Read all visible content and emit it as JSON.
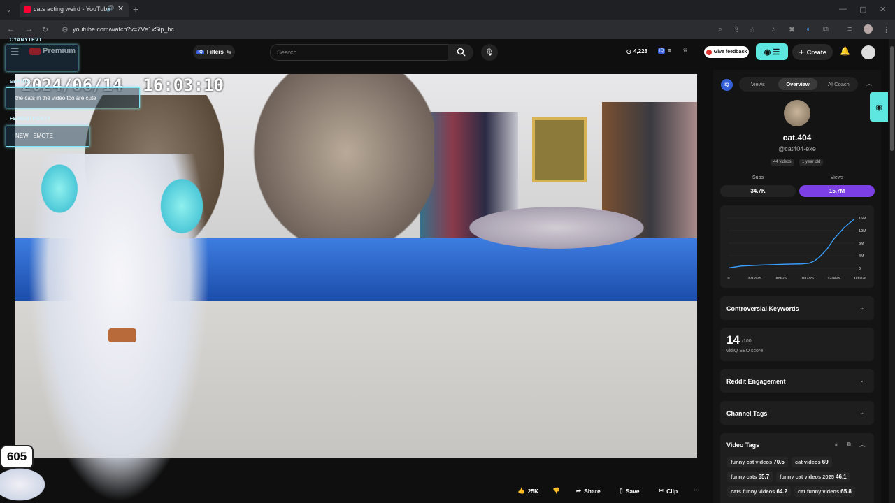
{
  "browser": {
    "tab_title": "cats acting weird - YouTube",
    "url": "youtube.com/watch?v=7Ve1xSip_bc"
  },
  "header": {
    "logo_text": "Premium",
    "filters_label": "Filters",
    "search_placeholder": "Search",
    "views_count": "4,228",
    "give_feedback": "Give feedback",
    "create_label": "Create"
  },
  "overlay": {
    "timestamp": "2024/06/14  16:03:10",
    "counter": "605",
    "chat": [
      {
        "user": "CYANYTEVT",
        "message": ""
      },
      {
        "user": "SEKRID",
        "message": "the cats in the video too are cute"
      },
      {
        "user": "FEMBOTFOXXY",
        "message": "NEW   EMOTE"
      }
    ]
  },
  "actions": {
    "likes": "25K",
    "share": "Share",
    "save": "Save",
    "clip": "Clip"
  },
  "sidebar": {
    "tabs": [
      "Views",
      "Overview",
      "AI Coach"
    ],
    "channel_name": "cat.404",
    "handle": "@cat404-exe",
    "videos": "44 videos",
    "age": "1 year old",
    "subs_label": "Subs",
    "subs_value": "34.7K",
    "views_label": "Views",
    "views_value": "15.7M",
    "controversial": "Controversial Keywords",
    "seo_score": "14",
    "seo_max": "/100",
    "seo_label": "vidIQ SEO score",
    "reddit": "Reddit Engagement",
    "channel_tags": "Channel Tags",
    "video_tags": "Video Tags",
    "tags": [
      {
        "name": "funny cat videos",
        "score": "70.5"
      },
      {
        "name": "cat videos",
        "score": "69"
      },
      {
        "name": "funny cats",
        "score": "65.7"
      },
      {
        "name": "funny cat videos 2025",
        "score": "46.1"
      },
      {
        "name": "cats funny videos",
        "score": "64.2"
      },
      {
        "name": "cat funny videos",
        "score": "65.8"
      }
    ]
  },
  "chart_data": {
    "type": "line",
    "x_ticks": [
      "0",
      "6/12/25",
      "8/9/25",
      "10/7/25",
      "12/4/25",
      "1/31/26"
    ],
    "y_ticks": [
      "0",
      "4M",
      "8M",
      "12M",
      "16M"
    ],
    "ylim": [
      0,
      16
    ],
    "points": [
      [
        0,
        0.1
      ],
      [
        0.1,
        0.7
      ],
      [
        0.25,
        1.0
      ],
      [
        0.45,
        1.3
      ],
      [
        0.58,
        1.4
      ],
      [
        0.64,
        1.6
      ],
      [
        0.68,
        2.3
      ],
      [
        0.72,
        3.5
      ],
      [
        0.78,
        6.0
      ],
      [
        0.84,
        9.5
      ],
      [
        0.92,
        13.0
      ],
      [
        1.0,
        15.7
      ]
    ],
    "color": "#3aa0ff"
  },
  "colors": {
    "accent_teal": "#7fe5f5",
    "views_purple": "#7b3fe4",
    "youtube_red": "#ff0000"
  }
}
